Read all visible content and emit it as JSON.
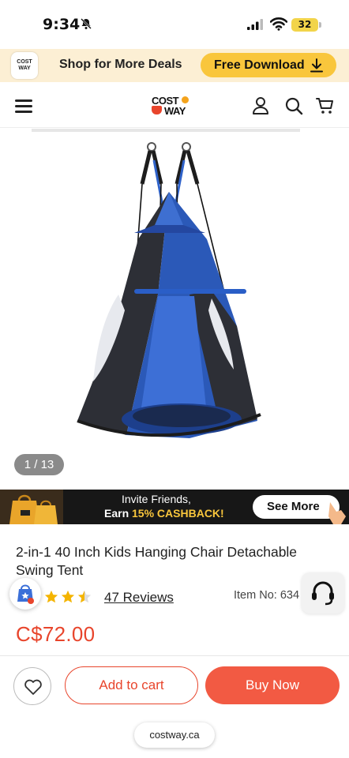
{
  "status_bar": {
    "time": "9:34",
    "battery": "32",
    "icons": [
      "bell-slash-icon",
      "signal-icon",
      "wifi-icon",
      "battery-icon"
    ]
  },
  "app_banner": {
    "logo_top": "COST",
    "logo_bottom": "WAY",
    "text": "Shop for More Deals",
    "button_label": "Free Download"
  },
  "header": {
    "logo_top": "COST",
    "logo_bottom": "WAY",
    "icons": [
      "menu-icon",
      "user-icon",
      "search-icon",
      "cart-icon"
    ]
  },
  "gallery": {
    "counter": "1 / 13"
  },
  "promo": {
    "line1": "Invite Friends,",
    "line2_prefix": "Earn ",
    "line2_highlight": "15% CASHBACK!",
    "button_label": "See More"
  },
  "product": {
    "title": "2-in-1 40 Inch Kids Hanging Chair Detachable Swing Tent",
    "rating": 4.5,
    "reviews_label": "47 Reviews",
    "item_no": "Item No: 634",
    "price": "C$72.00"
  },
  "actions": {
    "add_to_cart": "Add to cart",
    "buy_now": "Buy Now",
    "url": "costway.ca"
  },
  "colors": {
    "accent": "#e8452c",
    "buy_button": "#f25a43",
    "banner_bg": "#fcefd4",
    "banner_button": "#f9c63c",
    "promo_bg": "#171717",
    "star": "#f4b400"
  }
}
